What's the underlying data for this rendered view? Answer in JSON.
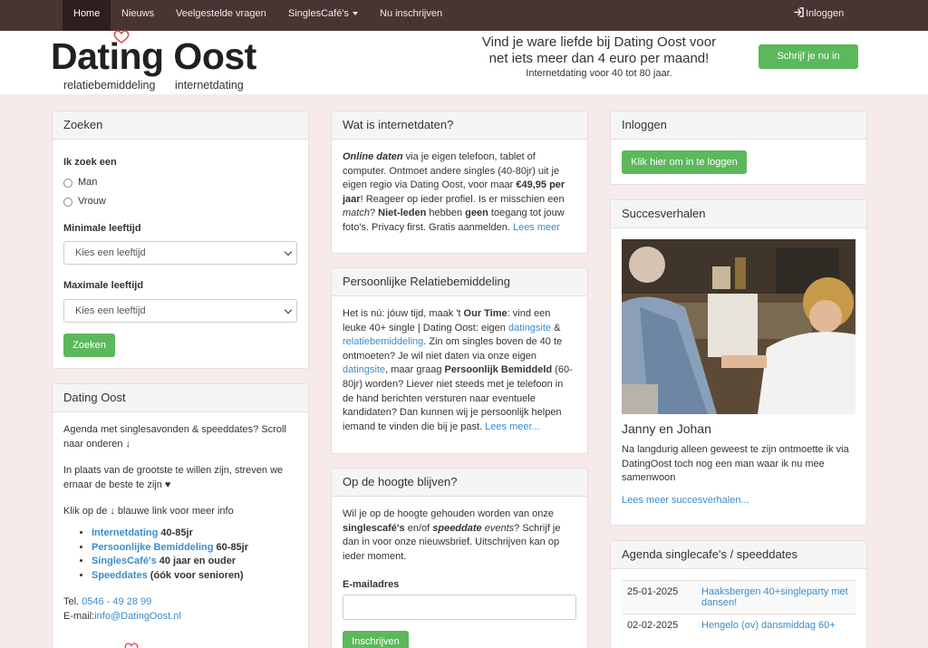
{
  "nav": {
    "home": "Home",
    "news": "Nieuws",
    "faq": "Veelgestelde vragen",
    "cafe": "SinglesCafé's",
    "signup": "Nu inschrijven",
    "login": "Inloggen"
  },
  "header": {
    "logo_title": "Dating Oost",
    "logo_sub_1": "relatiebemiddeling",
    "logo_sub_2": "internetdating",
    "tagline": "Vind je ware liefde bij Dating Oost voor net iets meer dan 4 euro per maand!",
    "tagline_small": "Internetdating voor 40 tot 80 jaar.",
    "signup_button": "Schrijf je nu in"
  },
  "search": {
    "title": "Zoeken",
    "looking_for_label": "Ik zoek een",
    "options": [
      "Man",
      "Vrouw"
    ],
    "min_age_label": "Minimale leeftijd",
    "min_age_value": "Kies een leeftijd",
    "max_age_label": "Maximale leeftijd",
    "max_age_value": "Kies een leeftijd",
    "button": "Zoeken"
  },
  "about": {
    "title": "Dating Oost",
    "p1": "Agenda met singlesavonden & speeddates? Scroll naar onderen ↓",
    "p2": "In plaats van de grootste te willen zijn, streven we ernaar de beste te zijn ♥",
    "p3": "Klik op de ↓ blauwe link voor meer info",
    "links": [
      {
        "link": "Internetdating",
        "suffix": " 40-85jr"
      },
      {
        "link": "Persoonlijke Bemiddeling",
        "suffix": " 60-85jr"
      },
      {
        "link": "SinglesCafé's",
        "suffix": " 40 jaar en ouder"
      },
      {
        "link": "Speeddates",
        "suffix": " (óók voor senioren)"
      }
    ],
    "tel_label": "Tel. ",
    "tel": "0546 - 49 28 99",
    "email_label": "E-mail:",
    "email": "info@DatingOost.nl"
  },
  "internet": {
    "title": "Wat is internetdaten?",
    "t1": "Online daten",
    "t2": " via je eigen telefoon, tablet of computer. Ontmoet andere singles (40-80jr) uit je eigen regio via Dating Oost, voor maar ",
    "t3": "€49,95 per jaar",
    "t4": "! Reageer op ieder profiel. Is er misschien een ",
    "t5": "match",
    "t6": "? ",
    "t7": "Niet-leden",
    "t8": " hebben ",
    "t9": "geen",
    "t10": " toegang tot jouw foto's. Privacy first. Gratis aanmelden. ",
    "more": "Lees meer"
  },
  "personal": {
    "title": "Persoonlijke Relatiebemiddeling",
    "t1": "Het is nú: jóuw tijd, maak 't ",
    "t2": "Our Time",
    "t3": ": vind een leuke 40+ single | Dating Oost: eigen ",
    "l1": "datingsite",
    "t4": " & ",
    "l2": "relatiebemiddeling",
    "t5": ". Zin om singles boven de 40 te ontmoeten? Je wil niet daten via onze eigen ",
    "l3": "datingsite",
    "t6": ", maar graag ",
    "t7": "Persoonlijk Bemiddeld",
    "t8": " (60-80jr) worden? Liever niet steeds met je telefoon in de hand berichten versturen naar eventuele kandidaten? Dan kunnen wij je persoonlijk helpen iemand te vinden die bij je past. ",
    "more": "Lees meer..."
  },
  "newsletter": {
    "title": "Op de hoogte blijven?",
    "t1": "Wil je op de hoogte gehouden worden van onze ",
    "t2": "singlescafé's",
    "t3": " en/of ",
    "t4": "speeddate",
    "t5": " ",
    "t6": "events",
    "t7": "? Schrijf je dan in voor onze nieuwsbrief. Uitschrijven kan op ieder moment.",
    "email_label": "E-mailadres",
    "button": "Inschrijven"
  },
  "login": {
    "title": "Inloggen",
    "button": "Klik hier om in te loggen"
  },
  "success": {
    "title": "Succesverhalen",
    "couple": "Janny en Johan",
    "story": "Na langdurig alleen geweest te zijn ontmoette ik via DatingOost toch nog een man waar ik nu mee samenwoon",
    "more": "Lees meer succesverhalen..."
  },
  "agenda": {
    "title": "Agenda singlecafe's / speeddates",
    "events": [
      {
        "date": "25-01-2025",
        "title": "Haaksbergen 40+singleparty met dansen!"
      },
      {
        "date": "02-02-2025",
        "title": "Hengelo (ov) dansmiddag 60+"
      }
    ]
  },
  "colors": {
    "navbar": "#4a3333",
    "navbar_active": "#2f1e1e",
    "page_bg": "#f7eaea",
    "green": "#5cb85c",
    "link": "#3a8ccb",
    "heart": "#d9534f"
  }
}
